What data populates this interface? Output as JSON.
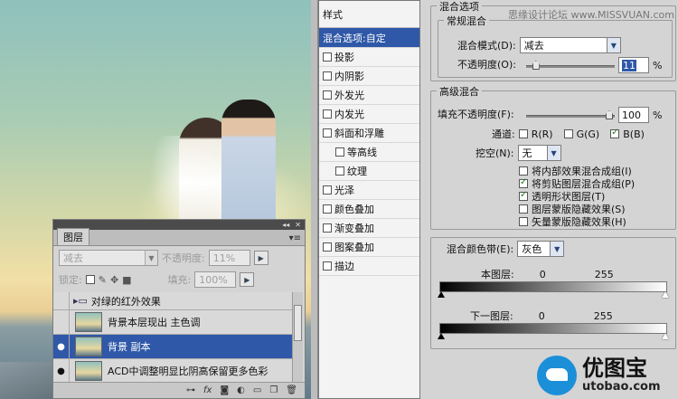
{
  "layers_panel": {
    "tab_label": "图层",
    "blend_mode": "减去",
    "opacity_label": "不透明度:",
    "opacity_value": "11%",
    "lock_label": "锁定:",
    "fill_label": "填充:",
    "fill_value": "100%",
    "layers": [
      {
        "name": "对绿的红外效果",
        "visible": false,
        "selected": false,
        "group": true
      },
      {
        "name": "背景本层现出 主色调",
        "visible": false,
        "selected": false,
        "group": false
      },
      {
        "name": "背景 副本",
        "visible": true,
        "selected": true,
        "group": false
      },
      {
        "name": "ACD中调整明显比阴高保留更多色彩",
        "visible": true,
        "selected": false,
        "group": false
      }
    ],
    "bottom_icons": [
      "link-icon",
      "fx-icon",
      "mask-icon",
      "adjustment-icon",
      "group-icon",
      "new-layer-icon",
      "trash-icon"
    ]
  },
  "dialog": {
    "styles_header": "样式",
    "watermark": "思缘设计论坛 www.MISSVUAN.com",
    "styles": [
      {
        "label": "混合选项:自定",
        "active": true,
        "checkbox": false,
        "indent": false
      },
      {
        "label": "投影",
        "active": false,
        "checkbox": true,
        "indent": false
      },
      {
        "label": "内阴影",
        "active": false,
        "checkbox": true,
        "indent": false
      },
      {
        "label": "外发光",
        "active": false,
        "checkbox": true,
        "indent": false
      },
      {
        "label": "内发光",
        "active": false,
        "checkbox": true,
        "indent": false
      },
      {
        "label": "斜面和浮雕",
        "active": false,
        "checkbox": true,
        "indent": false
      },
      {
        "label": "等高线",
        "active": false,
        "checkbox": true,
        "indent": true
      },
      {
        "label": "纹理",
        "active": false,
        "checkbox": true,
        "indent": true
      },
      {
        "label": "光泽",
        "active": false,
        "checkbox": true,
        "indent": false
      },
      {
        "label": "颜色叠加",
        "active": false,
        "checkbox": true,
        "indent": false
      },
      {
        "label": "渐变叠加",
        "active": false,
        "checkbox": true,
        "indent": false
      },
      {
        "label": "图案叠加",
        "active": false,
        "checkbox": true,
        "indent": false
      },
      {
        "label": "描边",
        "active": false,
        "checkbox": true,
        "indent": false
      }
    ],
    "blend_options_title": "混合选项",
    "general_blending": {
      "title": "常规混合",
      "mode_label": "混合模式(D):",
      "mode_value": "减去",
      "opacity_label": "不透明度(O):",
      "opacity_value": "11",
      "opacity_fraction": 0.11,
      "unit": "%"
    },
    "advanced_blending": {
      "title": "高级混合",
      "fill_label": "填充不透明度(F):",
      "fill_value": "100",
      "unit": "%",
      "channels_label": "通道:",
      "channels": [
        {
          "label": "R(R)",
          "checked": false
        },
        {
          "label": "G(G)",
          "checked": false
        },
        {
          "label": "B(B)",
          "checked": true
        }
      ],
      "knockout_label": "挖空(N):",
      "knockout_value": "无",
      "options": [
        {
          "label": "将内部效果混合成组(I)",
          "checked": false
        },
        {
          "label": "将剪贴图层混合成组(P)",
          "checked": true
        },
        {
          "label": "透明形状图层(T)",
          "checked": true
        },
        {
          "label": "图层蒙版隐藏效果(S)",
          "checked": false
        },
        {
          "label": "矢量蒙版隐藏效果(H)",
          "checked": false
        }
      ]
    },
    "blend_if": {
      "label": "混合颜色带(E):",
      "value": "灰色",
      "this_layer_label": "本图层:",
      "this_layer_min": "0",
      "this_layer_max": "255",
      "underlying_label": "下一图层:",
      "underlying_min": "0",
      "underlying_max": "255"
    }
  },
  "brand": {
    "name": "优图宝",
    "url": "utobao.com"
  }
}
